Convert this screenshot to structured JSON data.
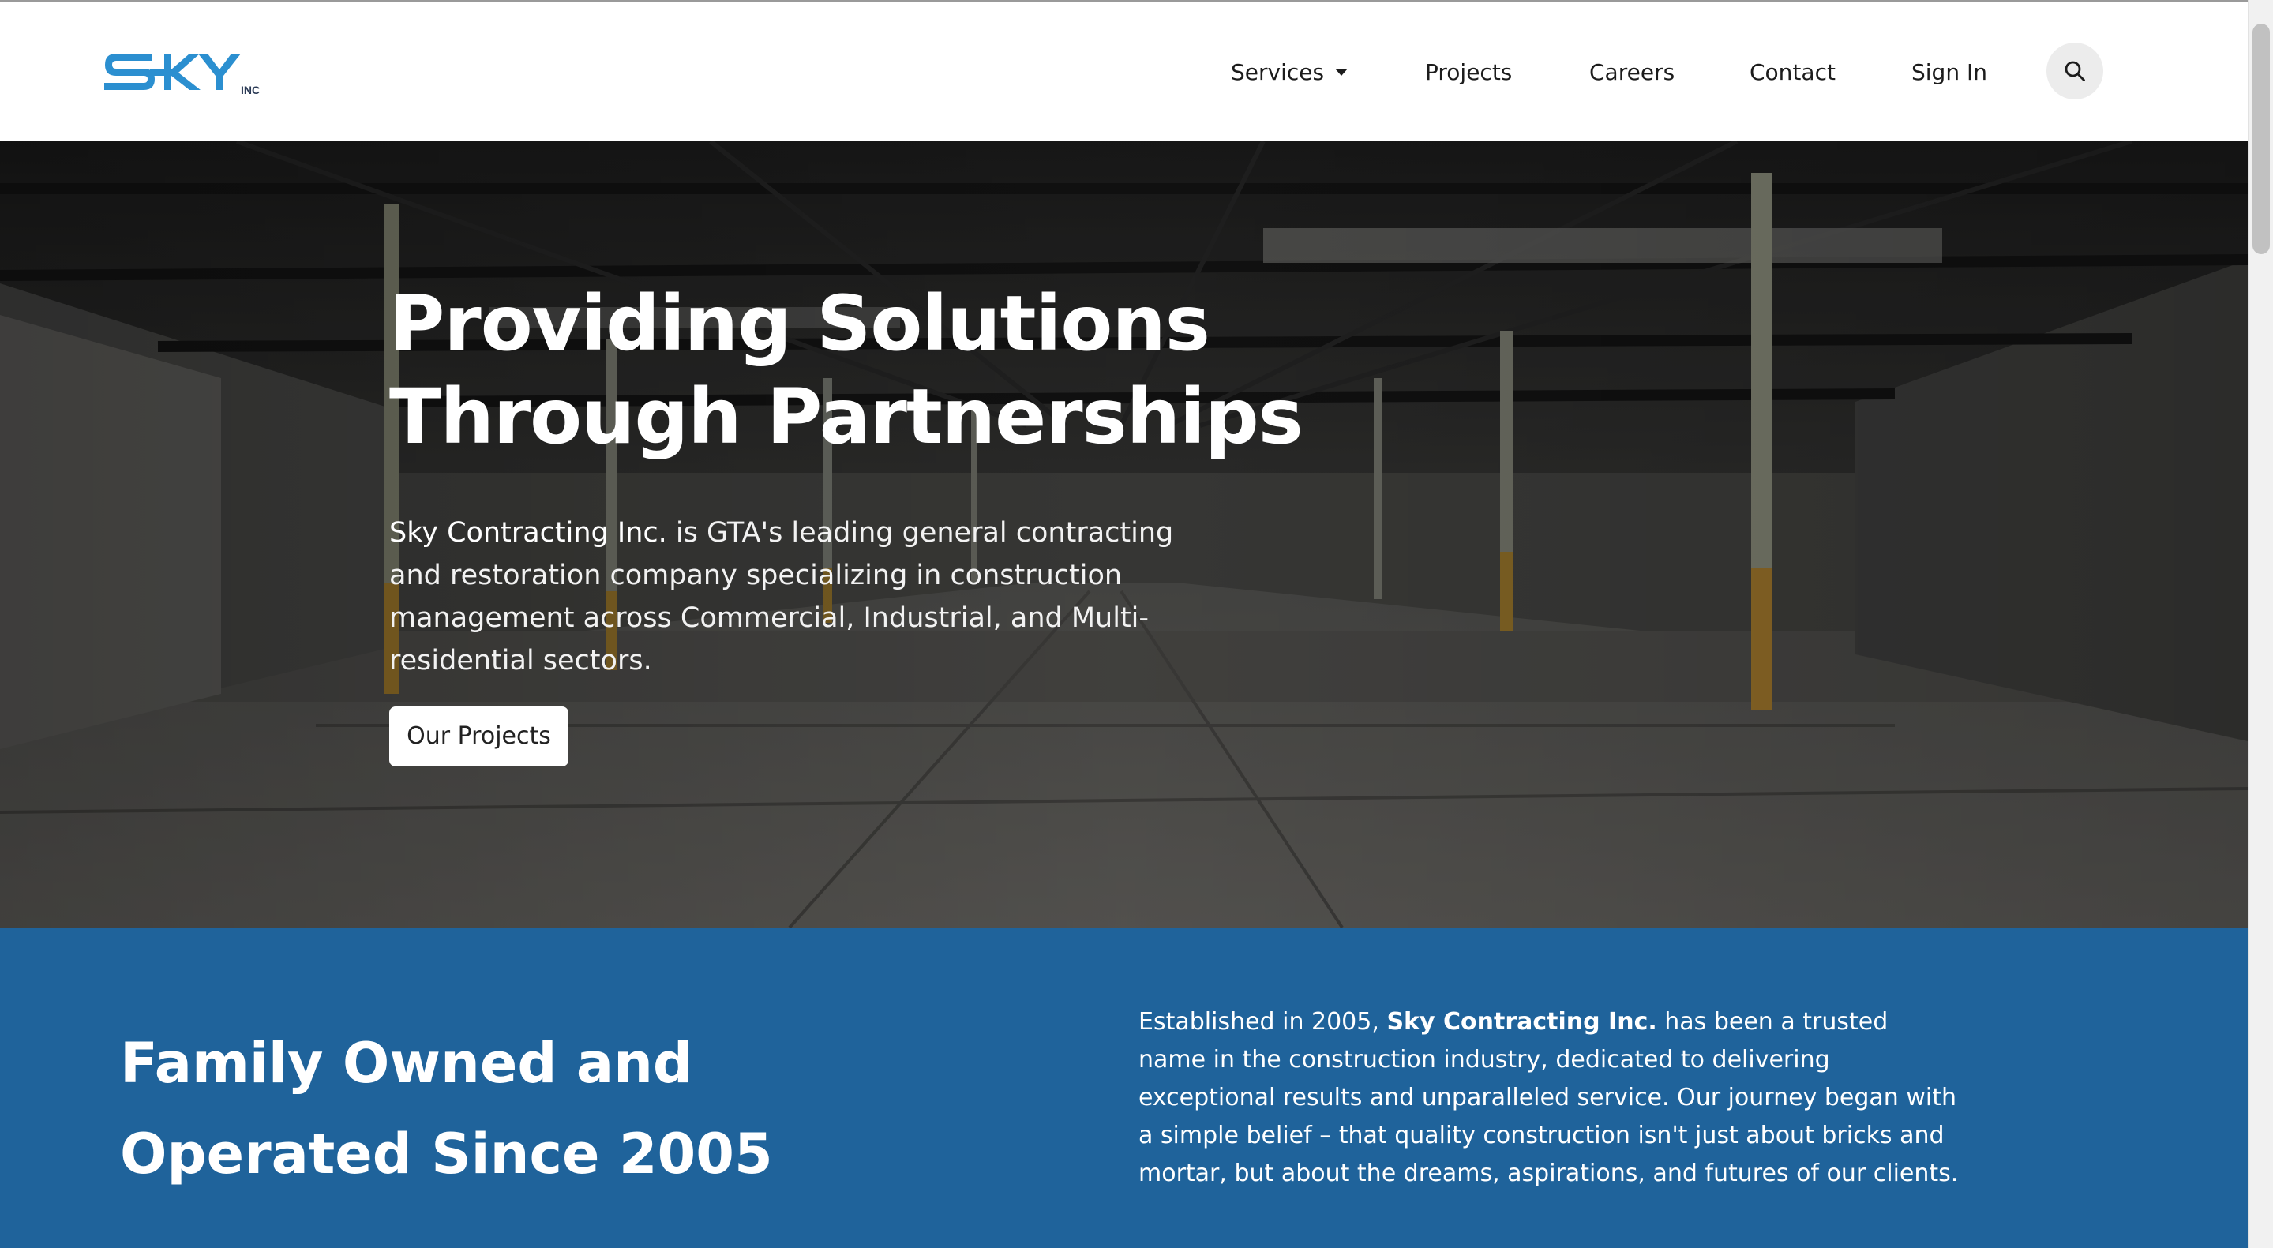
{
  "brand": {
    "logo_text": "SKY",
    "logo_suffix": "INC",
    "logo_color": "#2b8fd0"
  },
  "nav": {
    "items": [
      {
        "label": "Services",
        "has_dropdown": true
      },
      {
        "label": "Projects"
      },
      {
        "label": "Careers"
      },
      {
        "label": "Contact"
      },
      {
        "label": "Sign In"
      }
    ],
    "search_icon": "search-icon"
  },
  "hero": {
    "title_line1": "Providing Solutions",
    "title_line2": "Through Partnerships",
    "description_brand": "Sky Contracting Inc.",
    "description_rest": " is GTA's leading general contracting and restoration company specializing in construction management across Commercial, Industrial, and Multi-residential sectors.",
    "cta_label": "Our Projects",
    "background": "empty-warehouse-interior-photo"
  },
  "about": {
    "title_line1": "Family Owned and",
    "title_line2": "Operated Since 2005",
    "text_before": "Established in 2005, ",
    "text_brand": "Sky Contracting Inc.",
    "text_after": " has been a trusted name in the construction industry, dedicated to delivering exceptional results and unparalleled service. Our journey began with a simple belief – that quality construction isn't just about bricks and mortar, but about the dreams, aspirations, and futures of our clients.",
    "background_color": "#1f639b"
  }
}
